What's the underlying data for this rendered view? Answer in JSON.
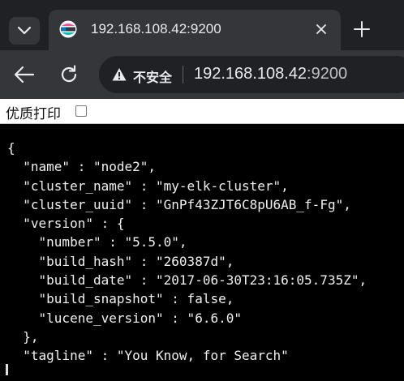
{
  "tab": {
    "title": "192.168.108.42:9200",
    "favicon": "elastic-logo-icon"
  },
  "toolbar": {
    "security_label": "不安全",
    "url_host": "192.168.108.42",
    "url_port": ":9200"
  },
  "pretty_print": {
    "label": "优质打印",
    "checked": false
  },
  "json_lines": [
    "{",
    "  \"name\" : \"node2\",",
    "  \"cluster_name\" : \"my-elk-cluster\",",
    "  \"cluster_uuid\" : \"GnPf43ZJT6C8pU6AB_f-Fg\",",
    "  \"version\" : {",
    "    \"number\" : \"5.5.0\",",
    "    \"build_hash\" : \"260387d\",",
    "    \"build_date\" : \"2017-06-30T23:16:05.735Z\",",
    "    \"build_snapshot\" : false,",
    "    \"lucene_version\" : \"6.6.0\"",
    "  },",
    "  \"tagline\" : \"You Know, for Search\""
  ],
  "colors": {
    "tab_strip": "#202124",
    "toolbar": "#35363a",
    "content_bg": "#000000",
    "text": "#e8eaed"
  }
}
